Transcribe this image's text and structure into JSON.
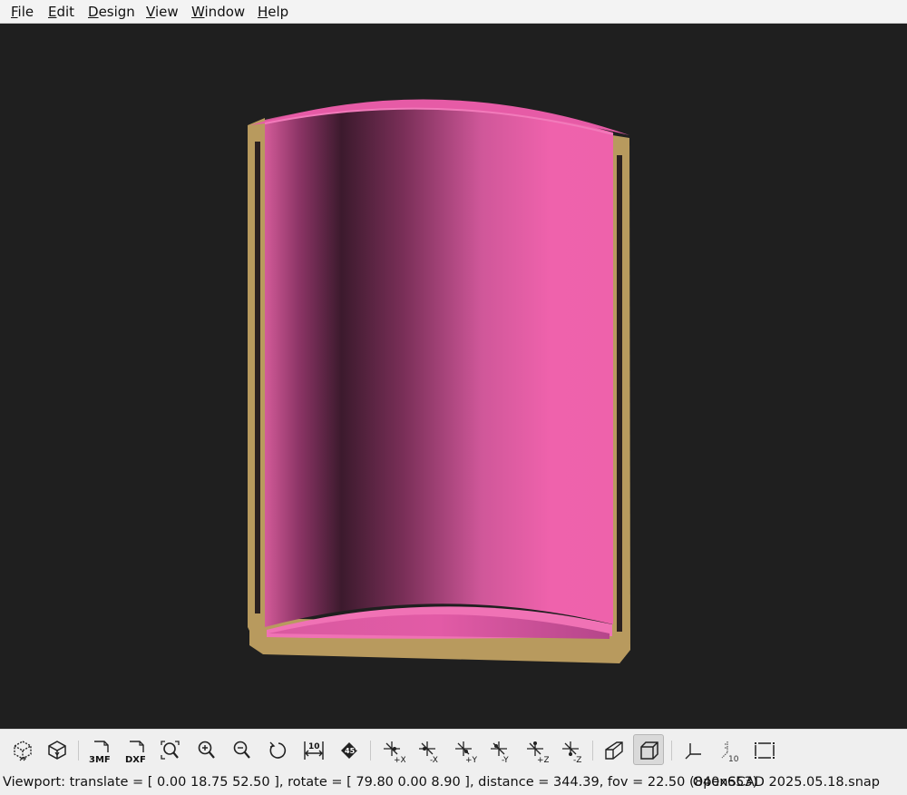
{
  "menubar": {
    "items": [
      {
        "accel": "F",
        "rest": "ile"
      },
      {
        "accel": "E",
        "rest": "dit"
      },
      {
        "accel": "D",
        "rest": "esign"
      },
      {
        "accel": "V",
        "rest": "iew"
      },
      {
        "accel": "W",
        "rest": "indow"
      },
      {
        "accel": "H",
        "rest": "elp"
      }
    ]
  },
  "colors": {
    "viewport_background": "#1f1f1f",
    "model_face": "#ec5fa8",
    "model_cut": "#b89a5e"
  },
  "toolbar": {
    "buttons": [
      {
        "icon": "preview-icon"
      },
      {
        "icon": "render-icon"
      },
      {
        "icon": "export-3mf-icon",
        "text": "3MF"
      },
      {
        "icon": "export-dxf-icon",
        "text": "DXF"
      },
      {
        "icon": "view-all-icon"
      },
      {
        "icon": "zoom-in-icon"
      },
      {
        "icon": "zoom-out-icon"
      },
      {
        "icon": "reset-view-icon"
      },
      {
        "icon": "measure-distance-icon",
        "text": "10"
      },
      {
        "icon": "measure-angle-icon",
        "text": "45°"
      },
      {
        "icon": "view-right-icon",
        "text": "+X"
      },
      {
        "icon": "view-left-icon",
        "text": "-X"
      },
      {
        "icon": "view-back-icon",
        "text": "+Y"
      },
      {
        "icon": "view-front-icon",
        "text": "-Y"
      },
      {
        "icon": "view-top-icon",
        "text": "+Z"
      },
      {
        "icon": "view-bottom-icon",
        "text": "-Z"
      },
      {
        "icon": "perspective-icon"
      },
      {
        "icon": "orthogonal-icon",
        "active": true
      },
      {
        "icon": "show-axes-icon"
      },
      {
        "icon": "show-scale-markers-icon",
        "text": "10"
      },
      {
        "icon": "show-edges-icon"
      }
    ]
  },
  "status": {
    "viewport_info": "Viewport: translate = [ 0.00 18.75 52.50 ], rotate = [ 79.80 0.00 8.90 ], distance = 344.39, fov = 22.50 (840x653)",
    "version": "OpenSCAD 2025.05.18.snap"
  }
}
